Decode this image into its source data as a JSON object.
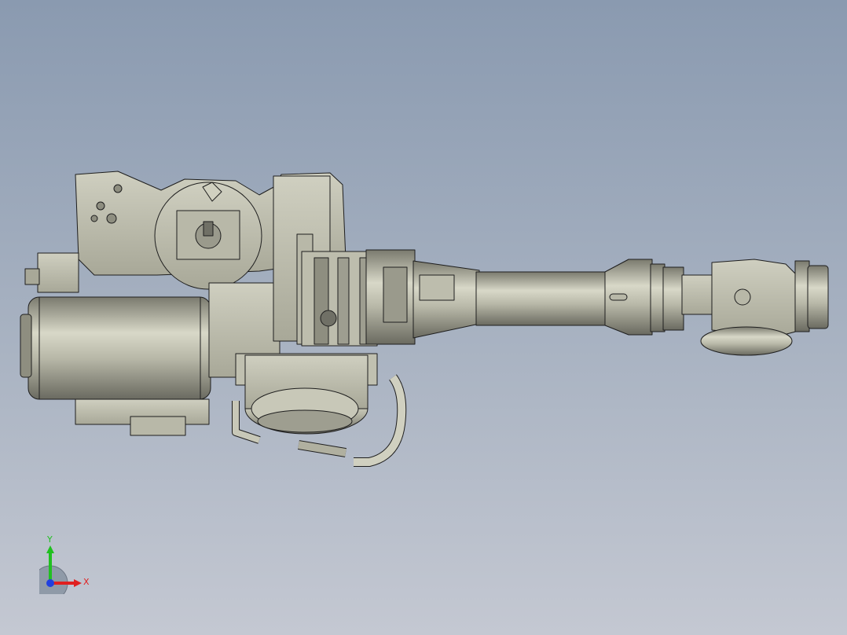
{
  "viewport": {
    "background_top": "#8a9ab0",
    "background_bottom": "#c4c8d2",
    "model_fill": "#c8c8b8",
    "model_shade": "#8e8e80",
    "edge_color": "#1e1e1e"
  },
  "triad": {
    "x_label": "X",
    "y_label": "Y",
    "x_color": "#e02020",
    "y_color": "#20c020",
    "z_color": "#2040e0"
  }
}
